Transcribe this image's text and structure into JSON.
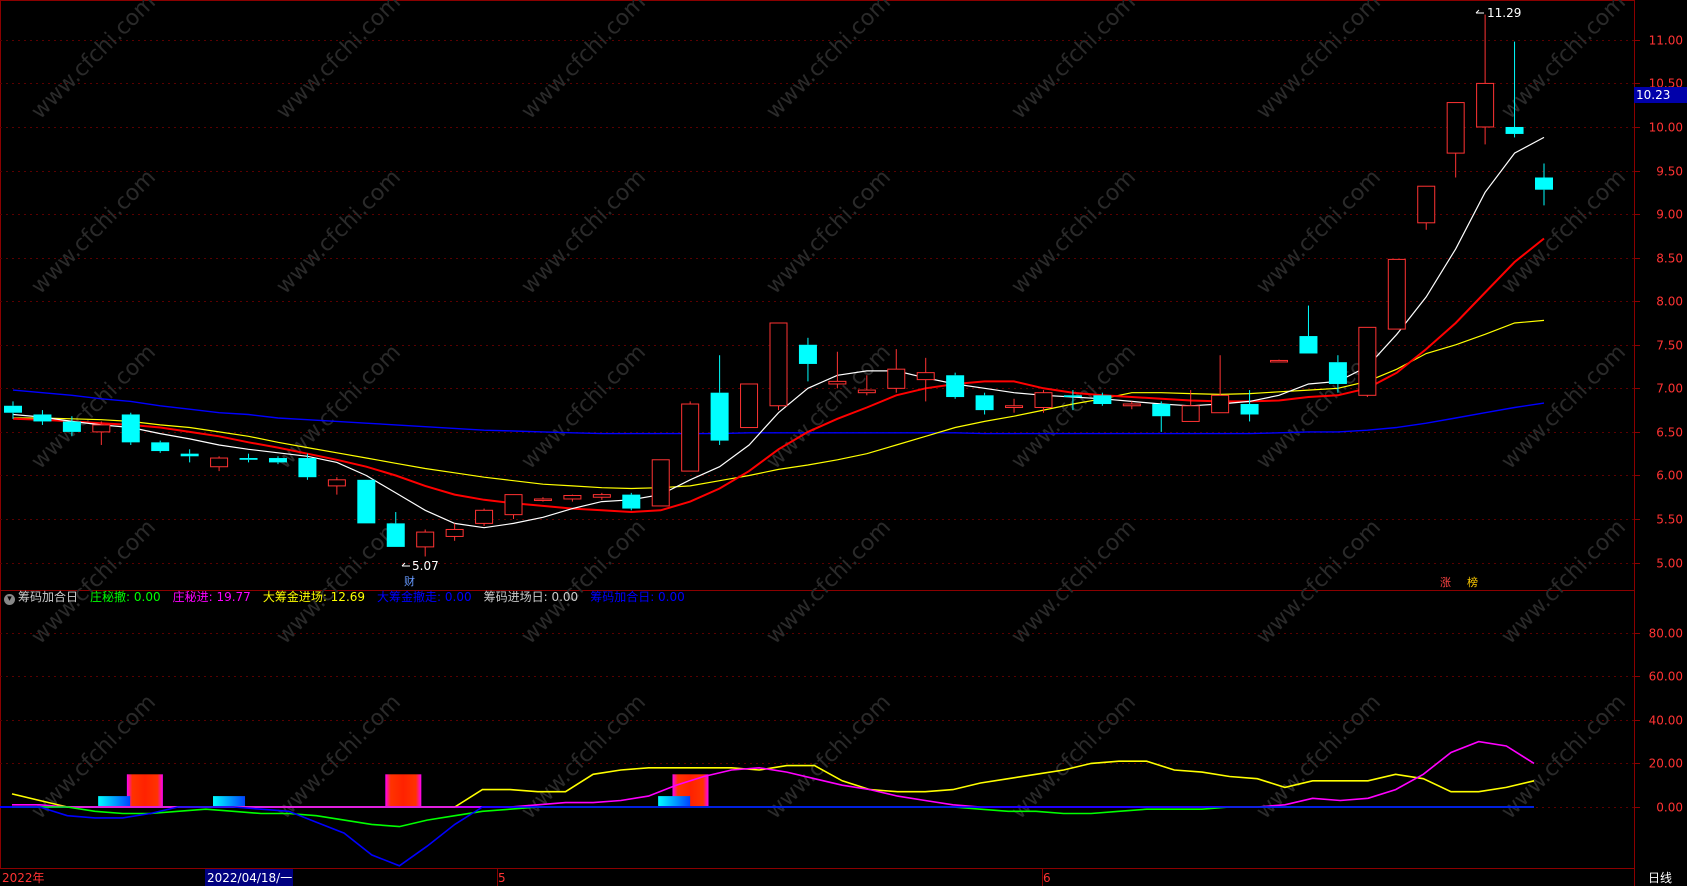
{
  "watermark": "www.cfchi.com",
  "price_labels": {
    "high": "11.29",
    "low": "5.07",
    "current": "10.23"
  },
  "markers": {
    "cai": "财",
    "zhang": "涨",
    "bang": "榜"
  },
  "indicator": {
    "name": "筹码加合日",
    "items": [
      {
        "label": "庄秘撤: 0.00",
        "color": "#00ff00"
      },
      {
        "label": "庄秘进: 19.77",
        "color": "#ff00ff"
      },
      {
        "label": "大筹金进场: 12.69",
        "color": "#ffff00"
      },
      {
        "label": "大筹金撤走: 0.00",
        "color": "#0000ff"
      },
      {
        "label": "筹码进场日: 0.00",
        "color": "#cccccc"
      },
      {
        "label": "筹码加合日: 0.00",
        "color": "#0000ff"
      }
    ]
  },
  "bottom": {
    "year": "2022年",
    "date": "2022/04/18/一",
    "m5": "5",
    "m6": "6",
    "period": "日线"
  },
  "colors": {
    "up": "#ff3333",
    "down": "#00ffff",
    "ma5": "#ffffff",
    "ma10": "#ff0000",
    "ma20": "#ffff00",
    "ma60": "#0000ff",
    "grid": "#8b0000"
  },
  "chart_data": [
    {
      "type": "candlestick",
      "ylim": [
        4.8,
        11.4
      ],
      "y_ticks": [
        "11.00",
        "10.50",
        "10.00",
        "9.50",
        "9.00",
        "8.50",
        "8.00",
        "7.50",
        "7.00",
        "6.50",
        "6.00",
        "5.50",
        "5.00"
      ],
      "candles": [
        {
          "o": 6.8,
          "h": 6.85,
          "l": 6.65,
          "c": 6.72
        },
        {
          "o": 6.7,
          "h": 6.75,
          "l": 6.58,
          "c": 6.62
        },
        {
          "o": 6.62,
          "h": 6.68,
          "l": 6.45,
          "c": 6.5
        },
        {
          "o": 6.5,
          "h": 6.62,
          "l": 6.35,
          "c": 6.58
        },
        {
          "o": 6.7,
          "h": 6.72,
          "l": 6.35,
          "c": 6.38
        },
        {
          "o": 6.38,
          "h": 6.4,
          "l": 6.26,
          "c": 6.28
        },
        {
          "o": 6.25,
          "h": 6.3,
          "l": 6.15,
          "c": 6.22
        },
        {
          "o": 6.1,
          "h": 6.22,
          "l": 6.05,
          "c": 6.2
        },
        {
          "o": 6.2,
          "h": 6.25,
          "l": 6.15,
          "c": 6.18
        },
        {
          "o": 6.2,
          "h": 6.22,
          "l": 6.13,
          "c": 6.15
        },
        {
          "o": 6.2,
          "h": 6.25,
          "l": 5.95,
          "c": 5.98
        },
        {
          "o": 5.88,
          "h": 5.98,
          "l": 5.78,
          "c": 5.95
        },
        {
          "o": 5.95,
          "h": 5.95,
          "l": 5.45,
          "c": 5.45
        },
        {
          "o": 5.45,
          "h": 5.58,
          "l": 5.18,
          "c": 5.18
        },
        {
          "o": 5.18,
          "h": 5.38,
          "l": 5.07,
          "c": 5.35
        },
        {
          "o": 5.3,
          "h": 5.45,
          "l": 5.25,
          "c": 5.38
        },
        {
          "o": 5.45,
          "h": 5.62,
          "l": 5.42,
          "c": 5.6
        },
        {
          "o": 5.55,
          "h": 5.78,
          "l": 5.5,
          "c": 5.78
        },
        {
          "o": 5.72,
          "h": 5.75,
          "l": 5.7,
          "c": 5.73
        },
        {
          "o": 5.73,
          "h": 5.78,
          "l": 5.7,
          "c": 5.77
        },
        {
          "o": 5.75,
          "h": 5.8,
          "l": 5.72,
          "c": 5.78
        },
        {
          "o": 5.78,
          "h": 5.8,
          "l": 5.6,
          "c": 5.62
        },
        {
          "o": 5.65,
          "h": 6.18,
          "l": 5.65,
          "c": 6.18
        },
        {
          "o": 6.05,
          "h": 6.85,
          "l": 6.05,
          "c": 6.82
        },
        {
          "o": 6.95,
          "h": 7.38,
          "l": 6.35,
          "c": 6.4
        },
        {
          "o": 6.55,
          "h": 7.05,
          "l": 6.55,
          "c": 7.05
        },
        {
          "o": 6.8,
          "h": 7.75,
          "l": 6.75,
          "c": 7.75
        },
        {
          "o": 7.5,
          "h": 7.58,
          "l": 7.08,
          "c": 7.28
        },
        {
          "o": 7.05,
          "h": 7.42,
          "l": 7.0,
          "c": 7.08
        },
        {
          "o": 6.95,
          "h": 7.15,
          "l": 6.92,
          "c": 6.98
        },
        {
          "o": 7.0,
          "h": 7.45,
          "l": 6.95,
          "c": 7.22
        },
        {
          "o": 7.1,
          "h": 7.35,
          "l": 6.85,
          "c": 7.18
        },
        {
          "o": 7.15,
          "h": 7.18,
          "l": 6.88,
          "c": 6.9
        },
        {
          "o": 6.92,
          "h": 6.95,
          "l": 6.7,
          "c": 6.75
        },
        {
          "o": 6.78,
          "h": 6.88,
          "l": 6.72,
          "c": 6.8
        },
        {
          "o": 6.78,
          "h": 6.98,
          "l": 6.72,
          "c": 6.95
        },
        {
          "o": 6.92,
          "h": 6.98,
          "l": 6.75,
          "c": 6.9
        },
        {
          "o": 6.92,
          "h": 6.95,
          "l": 6.8,
          "c": 6.82
        },
        {
          "o": 6.8,
          "h": 6.85,
          "l": 6.76,
          "c": 6.82
        },
        {
          "o": 6.82,
          "h": 6.85,
          "l": 6.5,
          "c": 6.68
        },
        {
          "o": 6.62,
          "h": 6.98,
          "l": 6.62,
          "c": 6.8
        },
        {
          "o": 6.72,
          "h": 7.38,
          "l": 6.72,
          "c": 6.92
        },
        {
          "o": 6.82,
          "h": 6.98,
          "l": 6.62,
          "c": 6.7
        },
        {
          "o": 7.32,
          "h": 7.33,
          "l": 7.31,
          "c": 7.32
        },
        {
          "o": 7.6,
          "h": 7.95,
          "l": 7.4,
          "c": 7.4
        },
        {
          "o": 7.3,
          "h": 7.38,
          "l": 6.95,
          "c": 7.05
        },
        {
          "o": 6.92,
          "h": 7.7,
          "l": 6.9,
          "c": 7.7
        },
        {
          "o": 7.68,
          "h": 8.48,
          "l": 7.68,
          "c": 8.48
        },
        {
          "o": 8.9,
          "h": 9.32,
          "l": 8.82,
          "c": 9.32
        },
        {
          "o": 9.7,
          "h": 10.28,
          "l": 9.42,
          "c": 10.28
        },
        {
          "o": 10.0,
          "h": 11.29,
          "l": 9.8,
          "c": 10.5
        },
        {
          "o": 10.0,
          "h": 10.98,
          "l": 9.88,
          "c": 9.92
        },
        {
          "o": 9.42,
          "h": 9.58,
          "l": 9.1,
          "c": 9.28
        }
      ],
      "ma5": [
        6.7,
        6.67,
        6.62,
        6.58,
        6.55,
        6.48,
        6.42,
        6.35,
        6.3,
        6.26,
        6.22,
        6.15,
        6.0,
        5.8,
        5.6,
        5.45,
        5.4,
        5.45,
        5.52,
        5.62,
        5.7,
        5.72,
        5.78,
        5.95,
        6.1,
        6.35,
        6.72,
        7.0,
        7.15,
        7.2,
        7.2,
        7.12,
        7.05,
        7.0,
        6.95,
        6.92,
        6.9,
        6.88,
        6.85,
        6.82,
        6.8,
        6.82,
        6.85,
        6.92,
        7.05,
        7.08,
        7.25,
        7.62,
        8.05,
        8.6,
        9.25,
        9.7,
        9.88
      ],
      "ma10": [
        6.65,
        6.64,
        6.62,
        6.6,
        6.58,
        6.55,
        6.5,
        6.45,
        6.38,
        6.32,
        6.25,
        6.18,
        6.1,
        6.0,
        5.88,
        5.78,
        5.72,
        5.68,
        5.65,
        5.62,
        5.6,
        5.58,
        5.6,
        5.7,
        5.85,
        6.05,
        6.3,
        6.5,
        6.65,
        6.78,
        6.92,
        7.0,
        7.05,
        7.08,
        7.08,
        7.0,
        6.95,
        6.92,
        6.9,
        6.88,
        6.86,
        6.85,
        6.85,
        6.86,
        6.9,
        6.92,
        7.0,
        7.18,
        7.45,
        7.75,
        8.1,
        8.45,
        8.72
      ],
      "ma20": [
        6.66,
        6.66,
        6.65,
        6.64,
        6.62,
        6.58,
        6.55,
        6.5,
        6.45,
        6.38,
        6.32,
        6.26,
        6.2,
        6.14,
        6.08,
        6.03,
        5.98,
        5.94,
        5.9,
        5.88,
        5.86,
        5.85,
        5.86,
        5.88,
        5.94,
        6.0,
        6.07,
        6.12,
        6.18,
        6.25,
        6.35,
        6.45,
        6.55,
        6.62,
        6.68,
        6.75,
        6.82,
        6.88,
        6.95,
        6.95,
        6.94,
        6.93,
        6.94,
        6.96,
        6.98,
        7.0,
        7.08,
        7.22,
        7.4,
        7.5,
        7.62,
        7.75,
        7.78
      ],
      "ma60": [
        6.98,
        6.95,
        6.92,
        6.88,
        6.85,
        6.8,
        6.76,
        6.72,
        6.7,
        6.66,
        6.64,
        6.62,
        6.6,
        6.58,
        6.56,
        6.54,
        6.52,
        6.51,
        6.5,
        6.49,
        6.48,
        6.48,
        6.48,
        6.48,
        6.48,
        6.49,
        6.49,
        6.49,
        6.49,
        6.49,
        6.49,
        6.49,
        6.49,
        6.48,
        6.48,
        6.48,
        6.48,
        6.48,
        6.48,
        6.48,
        6.48,
        6.48,
        6.48,
        6.49,
        6.5,
        6.5,
        6.52,
        6.55,
        6.6,
        6.66,
        6.72,
        6.78,
        6.83
      ]
    },
    {
      "type": "line",
      "ylim": [
        -28,
        95
      ],
      "y_ticks": [
        "80.00",
        "60.00",
        "40.00",
        "20.00",
        "0.00"
      ],
      "series": [
        {
          "name": "大筹金进场",
          "color": "#ffff00",
          "values": [
            6,
            3,
            0,
            0,
            0,
            0,
            0,
            0,
            0,
            0,
            0,
            0,
            0,
            0,
            0,
            0,
            0,
            8,
            8,
            7,
            7,
            15,
            17,
            18,
            18,
            18,
            18,
            17,
            19,
            19,
            12,
            8,
            7,
            7,
            8,
            11,
            13,
            15,
            17,
            20,
            21,
            21,
            17,
            16,
            14,
            13,
            9,
            12,
            12,
            12,
            15,
            13,
            7,
            7,
            9,
            12
          ]
        },
        {
          "name": "庄秘进",
          "color": "#ff00ff",
          "values": [
            1,
            1,
            0,
            0,
            0,
            0,
            0,
            0,
            0,
            0,
            0,
            0,
            0,
            0,
            0,
            0,
            0,
            0,
            0,
            1,
            2,
            2,
            3,
            5,
            10,
            14,
            17,
            18,
            16,
            13,
            10,
            8,
            5,
            3,
            1,
            0,
            0,
            0,
            0,
            0,
            0,
            0,
            0,
            0,
            0,
            0,
            1,
            4,
            3,
            4,
            8,
            15,
            25,
            30,
            28,
            20
          ]
        },
        {
          "name": "庄秘撤",
          "color": "#00ff00",
          "values": [
            0,
            0,
            0,
            -2,
            -3,
            -3,
            -2,
            -1,
            -2,
            -3,
            -3,
            -4,
            -6,
            -8,
            -9,
            -6,
            -4,
            -2,
            -1,
            0,
            0,
            0,
            0,
            0,
            0,
            0,
            0,
            0,
            0,
            0,
            0,
            0,
            0,
            0,
            0,
            -1,
            -2,
            -2,
            -3,
            -3,
            -2,
            -1,
            -1,
            -1,
            0,
            0,
            0,
            0,
            0,
            0,
            0,
            0,
            0,
            0,
            0,
            0
          ]
        },
        {
          "name": "大筹金撤走",
          "color": "#0000ff",
          "values": [
            0,
            0,
            -4,
            -5,
            -5,
            -3,
            0,
            0,
            0,
            -1,
            -2,
            -7,
            -12,
            -22,
            -27,
            -18,
            -8,
            0,
            0,
            0,
            0,
            0,
            0,
            0,
            0,
            0,
            0,
            0,
            0,
            0,
            0,
            0,
            0,
            0,
            0,
            0,
            0,
            0,
            0,
            0,
            0,
            0,
            0,
            0,
            0,
            0,
            0,
            0,
            0,
            0,
            0,
            0,
            0,
            0,
            0,
            0
          ]
        }
      ],
      "bars": [
        {
          "kind": "red",
          "from_idx": 4,
          "to_idx": 5,
          "top": 15,
          "bottom": 0
        },
        {
          "kind": "red",
          "from_idx": 13,
          "to_idx": 14,
          "top": 15,
          "bottom": 0
        },
        {
          "kind": "red",
          "from_idx": 23,
          "to_idx": 24,
          "top": 15,
          "bottom": 0
        },
        {
          "kind": "cyan",
          "from_idx": 3,
          "to_idx": 3.8,
          "top": 5,
          "bottom": 0
        },
        {
          "kind": "cyan",
          "from_idx": 7,
          "to_idx": 8.2,
          "top": 5,
          "bottom": 0
        },
        {
          "kind": "cyan",
          "from_idx": 22.5,
          "to_idx": 23.4,
          "top": 5,
          "bottom": 0
        }
      ]
    }
  ]
}
